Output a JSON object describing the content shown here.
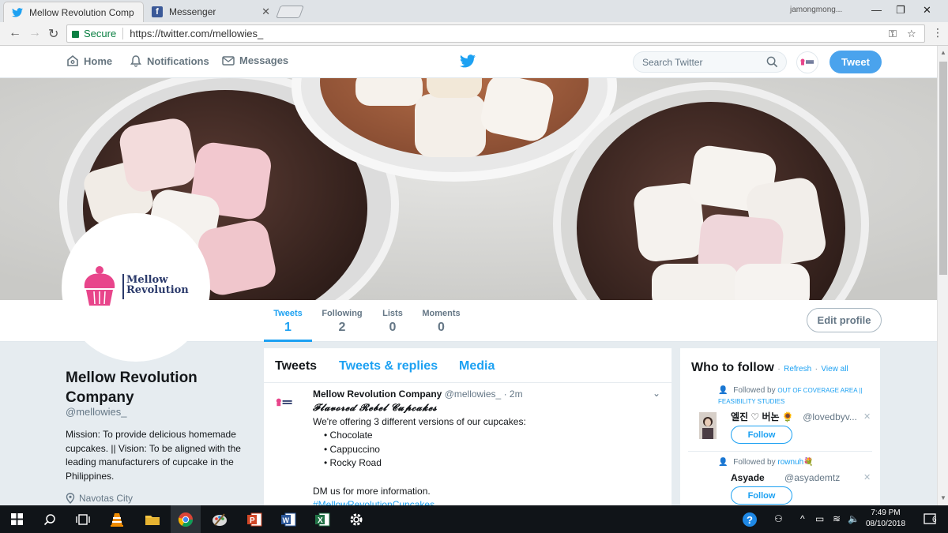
{
  "browser": {
    "tabs": [
      {
        "label": "Mellow Revolution Comp",
        "icon": "twitter-icon",
        "active": true
      },
      {
        "label": "Messenger",
        "icon": "facebook-icon",
        "active": false
      }
    ],
    "profile_name": "jamongmong...",
    "secure_label": "Secure",
    "url": "https://twitter.com/mellowies_"
  },
  "twitter_nav": {
    "home": "Home",
    "notifications": "Notifications",
    "messages": "Messages",
    "search_placeholder": "Search Twitter",
    "tweet_button": "Tweet"
  },
  "profile": {
    "name": "Mellow Revolution Company",
    "handle": "@mellowies_",
    "bio": "Mission: To provide delicious homemade cupcakes. || Vision: To be aligned with the leading manufacturers of cupcake in the Philippines.",
    "location": "Navotas City",
    "logo_text_line1": "Mellow",
    "logo_text_line2": "Revolution",
    "edit_profile": "Edit profile",
    "stats": [
      {
        "label": "Tweets",
        "value": "1"
      },
      {
        "label": "Following",
        "value": "2"
      },
      {
        "label": "Lists",
        "value": "0"
      },
      {
        "label": "Moments",
        "value": "0"
      }
    ]
  },
  "timeline": {
    "tabs": [
      "Tweets",
      "Tweets & replies",
      "Media"
    ],
    "tweet": {
      "name": "Mellow Revolution Company",
      "handle": "@mellowies_",
      "time": "· 2m",
      "line1": "𝓕𝓵𝓪𝓿𝓸𝓻𝓮𝓭 𝓡𝓮𝓫𝓮𝓵 𝓒𝓾𝓹𝓬𝓪𝓴𝓮𝓼",
      "line2": "We're offering 3 different versions of our cupcakes:",
      "items": [
        "Chocolate",
        "Cappuccino",
        "Rocky Road"
      ],
      "line3": "DM us for more information.",
      "hashtag": "#MellowRevolutionCupcakes"
    }
  },
  "who_to_follow": {
    "title": "Who to follow",
    "refresh": "Refresh",
    "view_all": "View all",
    "dot": "·",
    "suggestions": [
      {
        "context": "Followed by",
        "context_link": "OUT OF COVERAGE AREA || FEASIBILITY STUDIES",
        "name": "엘진 ♡ 버논 🌻",
        "handle": "@lovedbyv...",
        "follow": "Follow"
      },
      {
        "context": "Followed by",
        "context_link": "rownuh💐",
        "name": "Asyade",
        "handle": "@asyademtz",
        "follow": "Follow"
      }
    ]
  },
  "taskbar": {
    "time": "7:49 PM",
    "date": "08/10/2018",
    "notifications": "6"
  },
  "colors": {
    "twitter_blue": "#1da1f2",
    "logo_pink": "#e8458b",
    "logo_navy": "#2b3a6b"
  }
}
